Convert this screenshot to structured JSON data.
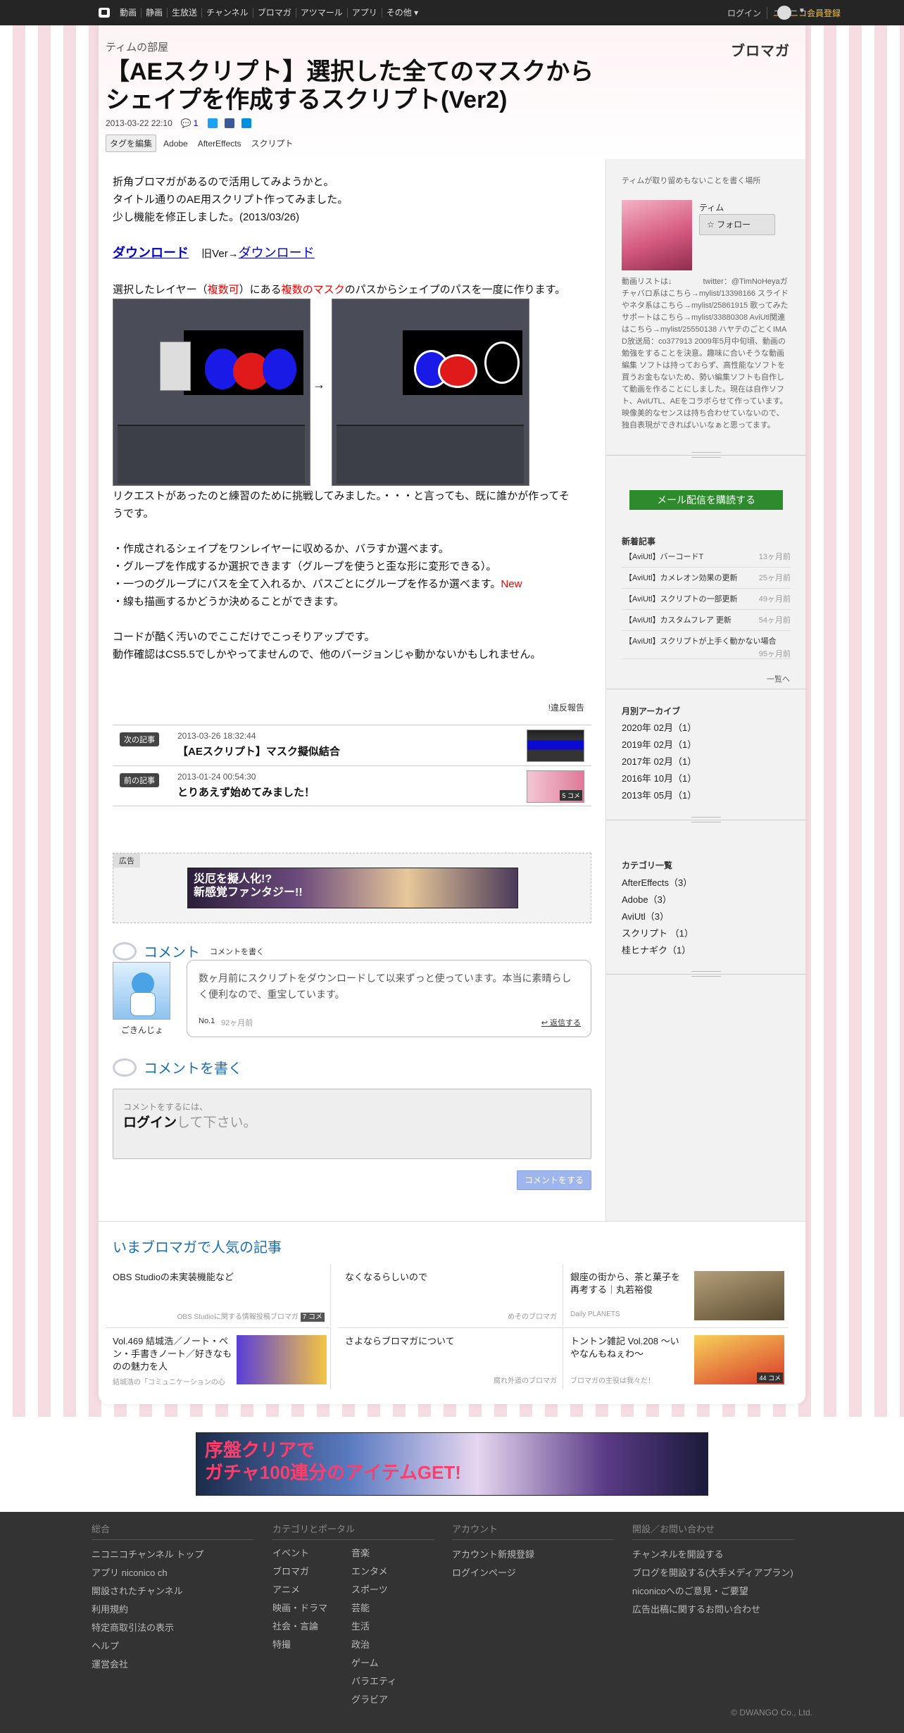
{
  "topbar": {
    "items": [
      "動画",
      "静画",
      "生放送",
      "チャンネル",
      "ブロマガ",
      "アツマール",
      "アプリ",
      "その他 ▾"
    ],
    "login": "ログイン",
    "register": "ニコニコ会員登録"
  },
  "header": {
    "channel": "ティムの部屋",
    "logo": "ブロマガ",
    "title": "【AEスクリプト】選択した全てのマスクからシェイプを作成するスクリプト(Ver2)",
    "date": "2013-03-22 22:10",
    "comment_count": "1",
    "edit_tags": "タグを編集",
    "tags": [
      "Adobe",
      "AfterEffects",
      "スクリプト"
    ]
  },
  "article": {
    "p1": "折角ブロマガがあるので活用してみようかと。",
    "p2": "タイトル通りのAE用スクリプト作ってみました。",
    "p3": "少し機能を修正しました。(2013/03/26)",
    "download": "ダウンロード",
    "old": "旧Ver→",
    "download_old": "ダウンロード",
    "sel_a": "選択したレイヤー（",
    "sel_b": "複数可",
    "sel_c": "）にある",
    "sel_d": "複数のマスク",
    "sel_e": "のパスからシェイプのパスを一度に作ります。",
    "arrow": "→",
    "req": "リクエストがあったのと練習のために挑戦してみました。・・・と言っても、既に誰かが作ってそうです。",
    "b1": "・作成されるシェイプをワンレイヤーに収めるか、バラすか選べます。",
    "b2": "・グループを作成するか選択できます（グループを使うと歪な形に変形できる）。",
    "b3": "・一つのグループにパスを全て入れるか、パスごとにグループを作るか選べます。",
    "b3new": "New",
    "b4": "・線も描画するかどうか決めることができます。",
    "c1": "コードが酷く汚いのでここだけでこっそりアップです。",
    "c2": "動作確認はCS5.5でしかやってませんので、他のバージョンじゃ動かないかもしれません。",
    "report": "!違反報告"
  },
  "nav": {
    "next_label": "次の記事",
    "next_date": "2013-03-26 18:32:44",
    "next_title": "【AEスクリプト】マスク擬似結合",
    "prev_label": "前の記事",
    "prev_date": "2013-01-24 00:54:30",
    "prev_title": "とりあえず始めてみました！",
    "prev_comments": "5 コメ"
  },
  "ad": {
    "label": "広告",
    "text": "災厄を擬人化!?\n新感覚ファンタジー!!"
  },
  "comments": {
    "heading": "コメント",
    "write_link": "コメントを書く",
    "author": "ごきんじょ",
    "text": "数ヶ月前にスクリプトをダウンロードして以来ずっと使っています。本当に素晴らしく便利なので、重宝しています。",
    "no": "No.1",
    "ago": "92ヶ月前",
    "reply": "返信する"
  },
  "form": {
    "heading": "コメントを書く",
    "p1": "コメントをするには、",
    "login": "ログイン",
    "p2": "して下さい。",
    "submit": "コメントをする"
  },
  "sidebar": {
    "lead": "ティムが取り留めもないことを書く場所",
    "name": "ティム",
    "follow": "☆ フォロー",
    "profile": "動画リストは↓　　　　twitter：@TimNoHeyaガチャバロ系はこちら→mylist/13398166 スライドやネタ系はこちら→mylist/25861915 歌ってみたサポートはこちら→mylist/33880308 AviUtl関連はこちら→mylist/25550138 ハヤテのごとくIMAD放送局：co377913 2009年5月中旬頃、動画の勉強をすることを決意。趣味に合いそうな動画編集 ソフトは持っておらず、高性能なソフトを買うお金もないため、勢い編集ソフトも自作して動画を作ることにしました。現在は自作ソフト、AviUTL、AEをコラボらせて作っています。映像美的なセンスは持ち合わせていないので、独自表現ができればいいなぁと思ってます。",
    "subscribe": "メール配信を購読する",
    "new_heading": "新着記事",
    "new": [
      {
        "t": "【AviUtl】バーコードT",
        "a": "13ヶ月前"
      },
      {
        "t": "【AviUtl】カメレオン効果の更新",
        "a": "25ヶ月前"
      },
      {
        "t": "【AviUtl】スクリプトの一部更新",
        "a": "49ヶ月前"
      },
      {
        "t": "【AviUtl】カスタムフレア 更新",
        "a": "54ヶ月前"
      },
      {
        "t": "【AviUtl】スクリプトが上手く動かない場合",
        "a": "95ヶ月前"
      }
    ],
    "more": "一覧へ",
    "archive_heading": "月別アーカイブ",
    "archive": [
      "2020年 02月（1）",
      "2019年 02月（1）",
      "2017年 02月（1）",
      "2016年 10月（1）",
      "2013年 05月（1）"
    ],
    "cat_heading": "カテゴリ一覧",
    "cats": [
      "AfterEffects（3）",
      "Adobe（3）",
      "AviUtl（3）",
      "スクリプト （1）",
      "桂ヒナギク（1）"
    ]
  },
  "popular": {
    "heading": "いまブロマガで人気の記事",
    "items": [
      {
        "t": "OBS Studioの未実装機能など",
        "s": "OBS Studioに関する情報投稿ブロマガ",
        "c": "7 コメ"
      },
      {
        "t": "なくなるらしいので",
        "s": "めそのブロマガ",
        "c": ""
      },
      {
        "t": "銀座の街から、茶と菓子を再考する｜丸若裕俊",
        "s": "Daily PLANETS",
        "c": ""
      },
      {
        "t": "Vol.469 結城浩／ノート・ペン・手書きノート／好きなものの魅力を人",
        "s": "結城浩の「コミュニケーションの心",
        "c": ""
      },
      {
        "t": "さよならブロマガについて",
        "s": "腐れ外道のブロマガ",
        "c": ""
      },
      {
        "t": "トントン雑記 Vol.208 ～いやなんもねぇわ～",
        "s": "ブロマガの主役は我々だ！",
        "c": "44 コメ"
      }
    ]
  },
  "ad2": {
    "text": "序盤クリアで\nガチャ100連分のアイテムGET!"
  },
  "footer": {
    "c1h": "総合",
    "c1": [
      "ニコニコチャンネル トップ",
      "アプリ niconico ch",
      "開設されたチャンネル",
      "利用規約",
      "特定商取引法の表示",
      "ヘルプ",
      "運営会社"
    ],
    "c2h": "カテゴリとポータル",
    "c2a": [
      "イベント",
      "ブロマガ",
      "アニメ",
      "映画・ドラマ",
      "社会・言論",
      "特撮"
    ],
    "c2b": [
      "音楽",
      "エンタメ",
      "スポーツ",
      "芸能",
      "生活",
      "政治",
      "ゲーム",
      "バラエティ",
      "グラビア"
    ],
    "c3h": "アカウント",
    "c3": [
      "アカウント新規登録",
      "ログインページ"
    ],
    "c4h": "開設／お問い合わせ",
    "c4": [
      "チャンネルを開設する",
      "ブログを開設する(大手メディアプラン)",
      "niconicoへのご意見・ご要望",
      "広告出稿に関するお問い合わせ"
    ],
    "copy": "© DWANGO Co., Ltd."
  }
}
